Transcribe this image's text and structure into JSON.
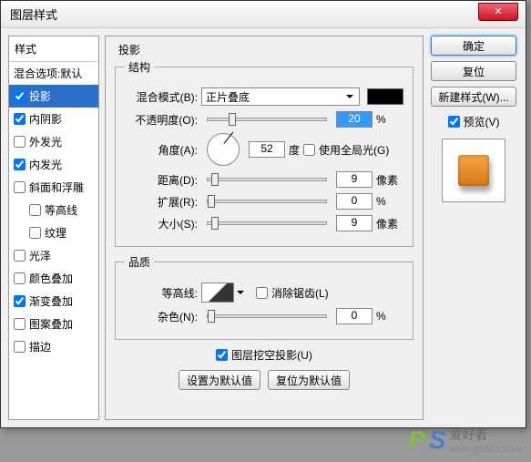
{
  "window": {
    "title": "图层样式"
  },
  "styles": {
    "header": "样式",
    "items": [
      {
        "label": "混合选项:默认",
        "checked": null
      },
      {
        "label": "投影",
        "checked": true,
        "selected": true
      },
      {
        "label": "内阴影",
        "checked": true
      },
      {
        "label": "外发光",
        "checked": false
      },
      {
        "label": "内发光",
        "checked": true
      },
      {
        "label": "斜面和浮雕",
        "checked": false
      },
      {
        "label": "等高线",
        "checked": false,
        "indent": true
      },
      {
        "label": "纹理",
        "checked": false,
        "indent": true
      },
      {
        "label": "光泽",
        "checked": false
      },
      {
        "label": "颜色叠加",
        "checked": false
      },
      {
        "label": "渐变叠加",
        "checked": true
      },
      {
        "label": "图案叠加",
        "checked": false
      },
      {
        "label": "描边",
        "checked": false
      }
    ]
  },
  "center": {
    "title": "投影",
    "structure": {
      "legend": "结构",
      "blend_label": "混合模式(B):",
      "blend_value": "正片叠底",
      "opacity_label": "不透明度(O):",
      "opacity_value": "20",
      "opacity_unit": "%",
      "angle_label": "角度(A):",
      "angle_value": "52",
      "angle_unit": "度",
      "global_light": "使用全局光(G)",
      "distance_label": "距离(D):",
      "distance_value": "9",
      "distance_unit": "像素",
      "spread_label": "扩展(R):",
      "spread_value": "0",
      "spread_unit": "%",
      "size_label": "大小(S):",
      "size_value": "9",
      "size_unit": "像素"
    },
    "quality": {
      "legend": "品质",
      "contour_label": "等高线:",
      "antialias": "消除锯齿(L)",
      "noise_label": "杂色(N):",
      "noise_value": "0",
      "noise_unit": "%"
    },
    "knockout": "图层挖空投影(U)",
    "set_default": "设置为默认值",
    "reset_default": "复位为默认值"
  },
  "right": {
    "ok": "确定",
    "cancel": "复位",
    "new_style": "新建样式(W)...",
    "preview": "预览(V)"
  },
  "watermark": {
    "brand": "爱好者",
    "url": "www.psahz.com"
  }
}
